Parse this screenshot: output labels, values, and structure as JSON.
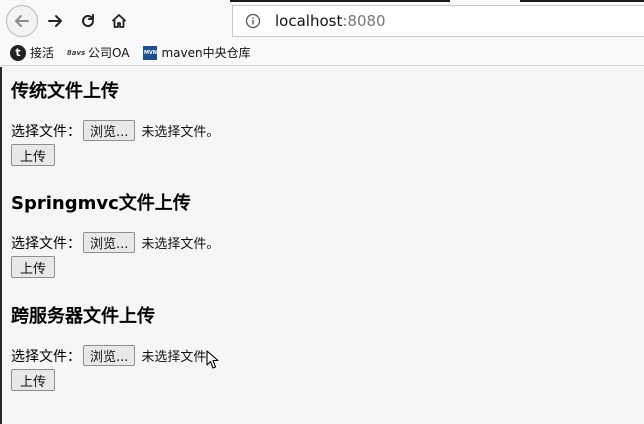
{
  "browser": {
    "url_host": "localhost",
    "url_port": ":8080",
    "bookmarks": [
      {
        "label": "接活",
        "icon": "t-circle-icon"
      },
      {
        "label": "公司OA",
        "icon": "oa-icon"
      },
      {
        "label": "maven中央仓库",
        "icon": "mvn-icon"
      }
    ]
  },
  "sections": [
    {
      "title": "传统文件上传",
      "file_label": "选择文件：",
      "browse_label": "浏览...",
      "no_file_text": "未选择文件。",
      "submit_label": "上传"
    },
    {
      "title": "Springmvc文件上传",
      "file_label": "选择文件：",
      "browse_label": "浏览...",
      "no_file_text": "未选择文件。",
      "submit_label": "上传"
    },
    {
      "title": "跨服务器文件上传",
      "file_label": "选择文件：",
      "browse_label": "浏览...",
      "no_file_text": "未选择文件。",
      "submit_label": "上传"
    }
  ]
}
